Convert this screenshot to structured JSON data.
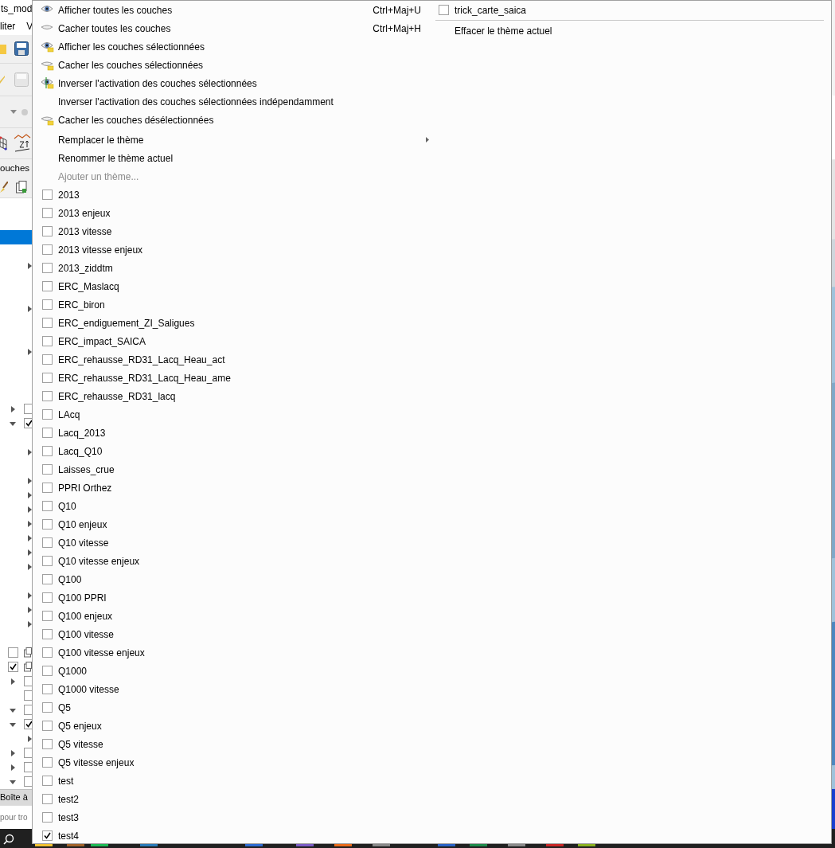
{
  "background_window": {
    "title": "ts_mod",
    "menu_bar": [
      "liter",
      "V"
    ],
    "panel_title": "ouches",
    "layer_tree": [
      {
        "kind": "empty"
      },
      {
        "kind": "empty"
      },
      {
        "kind": "selected-row"
      },
      {
        "kind": "empty"
      },
      {
        "kind": "sublayer",
        "expanded": false
      },
      {
        "kind": "empty"
      },
      {
        "kind": "empty"
      },
      {
        "kind": "sublayer",
        "expanded": false
      },
      {
        "kind": "empty"
      },
      {
        "kind": "empty"
      },
      {
        "kind": "sublayer",
        "expanded": false
      },
      {
        "kind": "empty"
      },
      {
        "kind": "empty"
      },
      {
        "kind": "empty"
      },
      {
        "kind": "group",
        "expanded": false,
        "checked": false
      },
      {
        "kind": "group",
        "expanded": true,
        "checked": true
      },
      {
        "kind": "empty"
      },
      {
        "kind": "sublayer",
        "expanded": false
      },
      {
        "kind": "empty"
      },
      {
        "kind": "sublayer",
        "expanded": false
      },
      {
        "kind": "sublayer",
        "expanded": false
      },
      {
        "kind": "sublayer",
        "expanded": false
      },
      {
        "kind": "sublayer",
        "expanded": false
      },
      {
        "kind": "sublayer",
        "expanded": false
      },
      {
        "kind": "sublayer",
        "expanded": false
      },
      {
        "kind": "sublayer",
        "expanded": false
      },
      {
        "kind": "empty"
      },
      {
        "kind": "sublayer",
        "expanded": false
      },
      {
        "kind": "sublayer",
        "expanded": false
      },
      {
        "kind": "sublayer",
        "expanded": false
      },
      {
        "kind": "empty"
      },
      {
        "kind": "layer",
        "checked": false
      },
      {
        "kind": "layer",
        "checked": true
      },
      {
        "kind": "group",
        "expanded": false,
        "checked": false
      },
      {
        "kind": "leaf",
        "checked": false
      },
      {
        "kind": "group",
        "expanded": true,
        "checked": false
      },
      {
        "kind": "group",
        "expanded": true,
        "checked": true
      },
      {
        "kind": "sublayer",
        "expanded": false
      },
      {
        "kind": "group",
        "expanded": false,
        "checked": false
      },
      {
        "kind": "group",
        "expanded": false,
        "checked": false
      },
      {
        "kind": "group",
        "expanded": true,
        "checked": false
      }
    ],
    "bottom_tab": "Boîte à",
    "search": {
      "placeholder": "pour tro"
    }
  },
  "context_menu": {
    "actions": [
      {
        "label": "Afficher toutes les couches",
        "shortcut": "Ctrl+Maj+U",
        "kind": "show-all"
      },
      {
        "label": "Cacher toutes les couches",
        "shortcut": "Ctrl+Maj+H",
        "kind": "hide-all"
      },
      {
        "label": "Afficher les couches sélectionnées",
        "kind": "show-selected"
      },
      {
        "label": "Cacher les couches sélectionnées",
        "kind": "hide-selected"
      },
      {
        "label": "Inverser l'activation des couches sélectionnées",
        "kind": "toggle-selected"
      },
      {
        "label": "Inverser l'activation des couches sélectionnées indépendamment",
        "kind": "plain"
      },
      {
        "label": "Cacher les couches désélectionnées",
        "kind": "hide-unselected"
      }
    ],
    "theme_actions": [
      {
        "label": "Remplacer le thème",
        "submenu": true,
        "disabled": false
      },
      {
        "label": "Renommer le thème actuel",
        "submenu": false,
        "disabled": false
      },
      {
        "label": "Ajouter un thème...",
        "submenu": false,
        "disabled": true
      }
    ],
    "themes": [
      {
        "label": "2013",
        "checked": false
      },
      {
        "label": "2013 enjeux",
        "checked": false
      },
      {
        "label": "2013 vitesse",
        "checked": false
      },
      {
        "label": "2013 vitesse enjeux",
        "checked": false
      },
      {
        "label": "2013_ziddtm",
        "checked": false
      },
      {
        "label": "ERC_Maslacq",
        "checked": false
      },
      {
        "label": "ERC_biron",
        "checked": false
      },
      {
        "label": "ERC_endiguement_ZI_Saligues",
        "checked": false
      },
      {
        "label": "ERC_impact_SAICA",
        "checked": false
      },
      {
        "label": "ERC_rehausse_RD31_Lacq_Heau_act",
        "checked": false
      },
      {
        "label": "ERC_rehausse_RD31_Lacq_Heau_ame",
        "checked": false
      },
      {
        "label": "ERC_rehausse_RD31_lacq",
        "checked": false
      },
      {
        "label": "LAcq",
        "checked": false
      },
      {
        "label": "Lacq_2013",
        "checked": false
      },
      {
        "label": "Lacq_Q10",
        "checked": false
      },
      {
        "label": "Laisses_crue",
        "checked": false
      },
      {
        "label": "PPRI Orthez",
        "checked": false
      },
      {
        "label": "Q10",
        "checked": false
      },
      {
        "label": "Q10 enjeux",
        "checked": false
      },
      {
        "label": "Q10 vitesse",
        "checked": false
      },
      {
        "label": "Q10 vitesse enjeux",
        "checked": false
      },
      {
        "label": "Q100",
        "checked": false
      },
      {
        "label": "Q100 PPRI",
        "checked": false
      },
      {
        "label": "Q100 enjeux",
        "checked": false
      },
      {
        "label": "Q100 vitesse",
        "checked": false
      },
      {
        "label": "Q100 vitesse enjeux",
        "checked": false
      },
      {
        "label": "Q1000",
        "checked": false
      },
      {
        "label": "Q1000 vitesse",
        "checked": false
      },
      {
        "label": "Q5",
        "checked": false
      },
      {
        "label": "Q5 enjeux",
        "checked": false
      },
      {
        "label": "Q5 vitesse",
        "checked": false
      },
      {
        "label": "Q5 vitesse enjeux",
        "checked": false
      },
      {
        "label": "test",
        "checked": false
      },
      {
        "label": "test2",
        "checked": false
      },
      {
        "label": "test3",
        "checked": false
      },
      {
        "label": "test4",
        "checked": true
      },
      {
        "label": "trick_carte_saica",
        "checked": false
      }
    ],
    "clear_action": {
      "label": "Effacer le thème actuel"
    }
  }
}
